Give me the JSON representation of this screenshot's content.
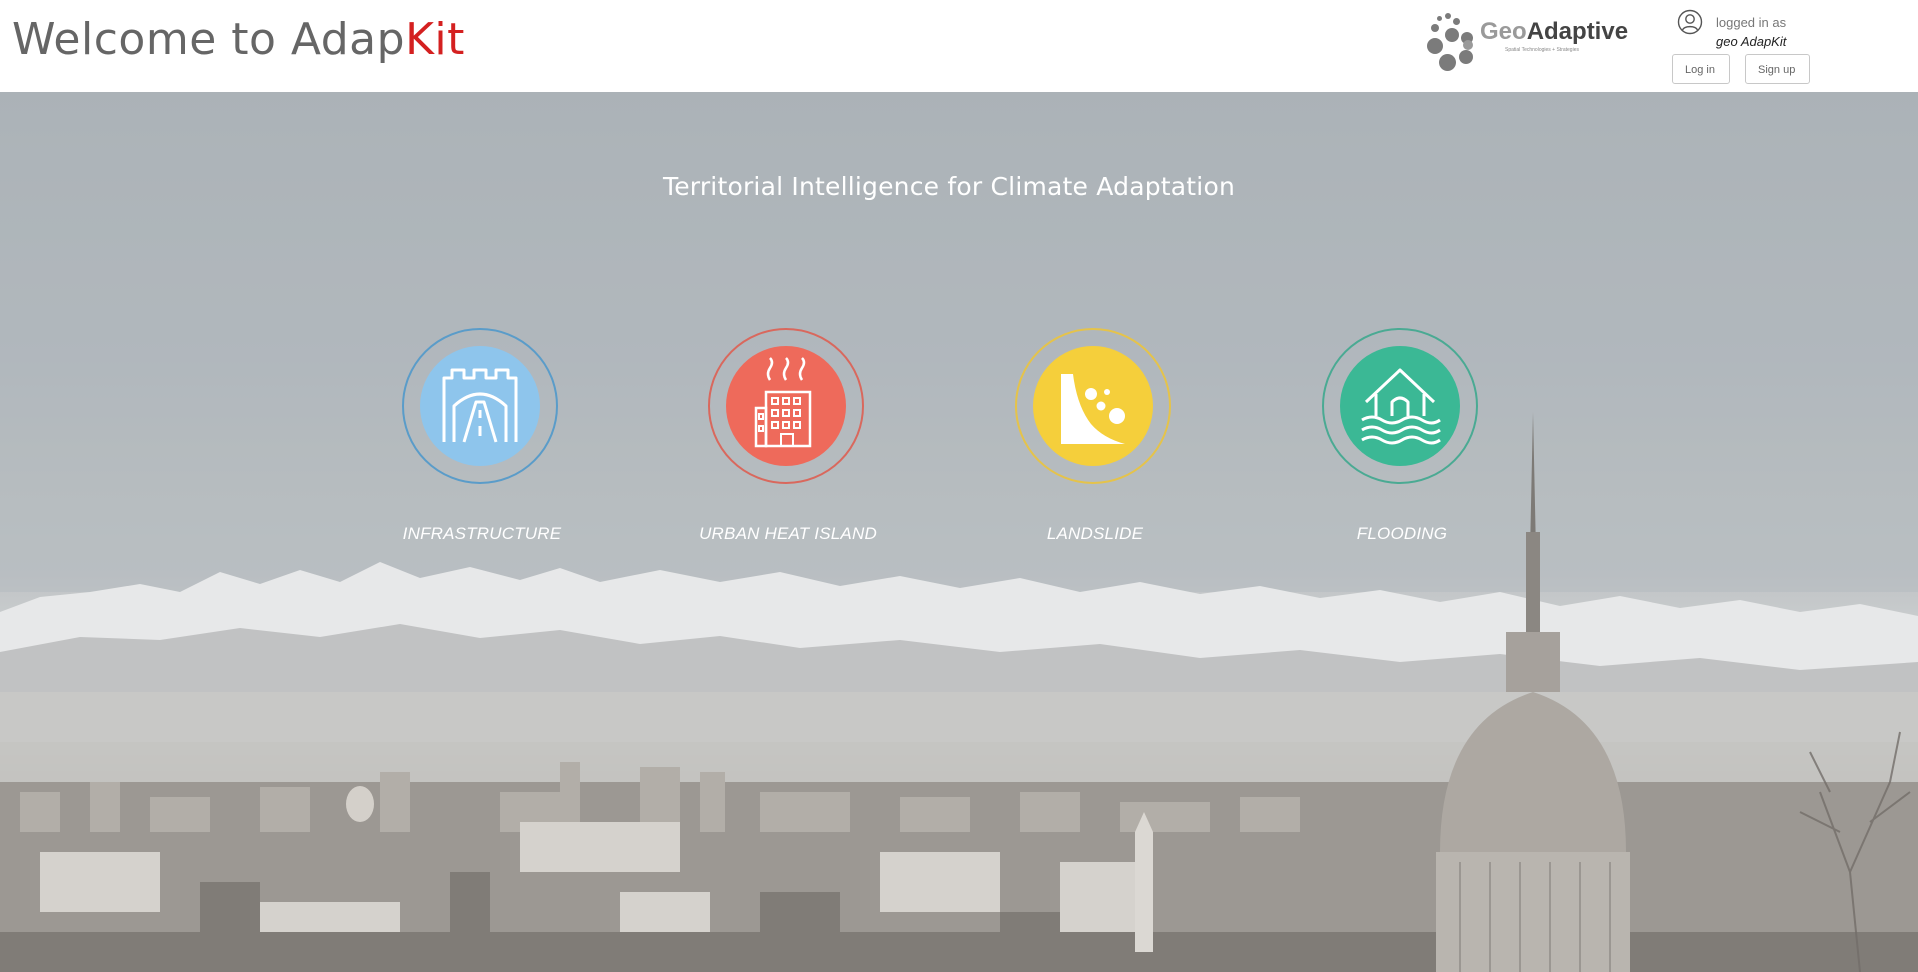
{
  "header": {
    "title_prefix": "Welcome to Adap",
    "title_accent": "Kit",
    "logo": {
      "geo": "Geo",
      "rest": "Adaptive",
      "tagline": "Spatial Technologies + Strategies"
    },
    "user": {
      "logged_label": "logged in as",
      "username": "geo AdapKit"
    },
    "login_label": "Log in",
    "signup_label": "Sign up"
  },
  "hero": {
    "tagline": "Territorial Intelligence for Climate Adaptation",
    "categories": [
      {
        "label": "INFRASTRUCTURE",
        "icon": "road-tunnel-icon",
        "color": "#8ec5ec",
        "ring": "#5a9cc9"
      },
      {
        "label": "URBAN HEAT ISLAND",
        "icon": "hot-building-icon",
        "color": "#ee6a5b",
        "ring": "#d9685d"
      },
      {
        "label": "LANDSLIDE",
        "icon": "landslide-icon",
        "color": "#f5cf3b",
        "ring": "#e5c34a"
      },
      {
        "label": "FLOODING",
        "icon": "flood-house-icon",
        "color": "#3bb895",
        "ring": "#4aaa93"
      }
    ]
  },
  "colors": {
    "accent": "#d42020",
    "text_gray": "#666666"
  }
}
